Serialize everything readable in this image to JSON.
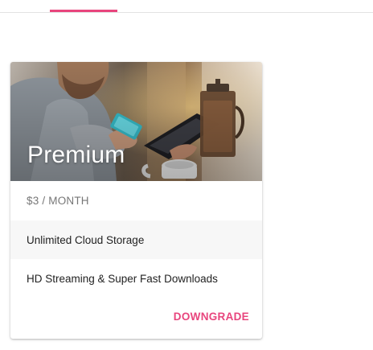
{
  "tabs": {
    "active_indicator_color": "#e8457d"
  },
  "plan_card": {
    "image_icon": "person-using-phone-image",
    "title": "Premium",
    "price": "$3 / MONTH",
    "features": [
      "Unlimited Cloud Storage",
      "HD Streaming & Super Fast Downloads"
    ],
    "action_label": "DOWNGRADE",
    "accent_color": "#e8457d"
  }
}
